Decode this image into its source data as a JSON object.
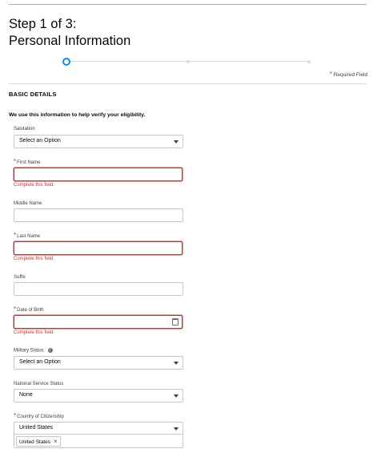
{
  "header": {
    "step": "Step 1 of 3:",
    "title": "Personal Information"
  },
  "progress": {
    "current_step": 1,
    "total_steps": 3
  },
  "required_legend": {
    "star": "*",
    "text": "Required Field"
  },
  "section": {
    "heading": "BASIC DETAILS",
    "intro": "We use this information to help verify your eligibility."
  },
  "fields": {
    "salutation": {
      "label": "Salutation",
      "value": "Select an Option"
    },
    "first_name": {
      "star": "*",
      "label": "First Name",
      "value": "",
      "error": "Complete this field."
    },
    "middle_name": {
      "label": "Middle Name",
      "value": ""
    },
    "last_name": {
      "star": "*",
      "label": "Last Name",
      "value": "",
      "error": "Complete this field."
    },
    "suffix": {
      "label": "Suffix",
      "value": ""
    },
    "date_of_birth": {
      "star": "*",
      "label": "Date of Birth",
      "value": "",
      "error": "Complete this field."
    },
    "military_status": {
      "label": "Military Status",
      "info_glyph": "i",
      "value": "Select an Option"
    },
    "national_service_status": {
      "label": "National Service Status",
      "value": "None"
    },
    "country_of_citizenship": {
      "star": "*",
      "label": "Country of Citizenship",
      "value": "United States",
      "selected": [
        {
          "label": "United States",
          "remove_glyph": "×"
        }
      ]
    }
  },
  "colors": {
    "accent": "#1589ee",
    "error": "#c23934",
    "border": "#c9c7c5"
  },
  "icons": {
    "dropdown": "chevron-down-icon",
    "calendar": "calendar-icon",
    "info": "info-icon",
    "remove": "close-icon"
  }
}
